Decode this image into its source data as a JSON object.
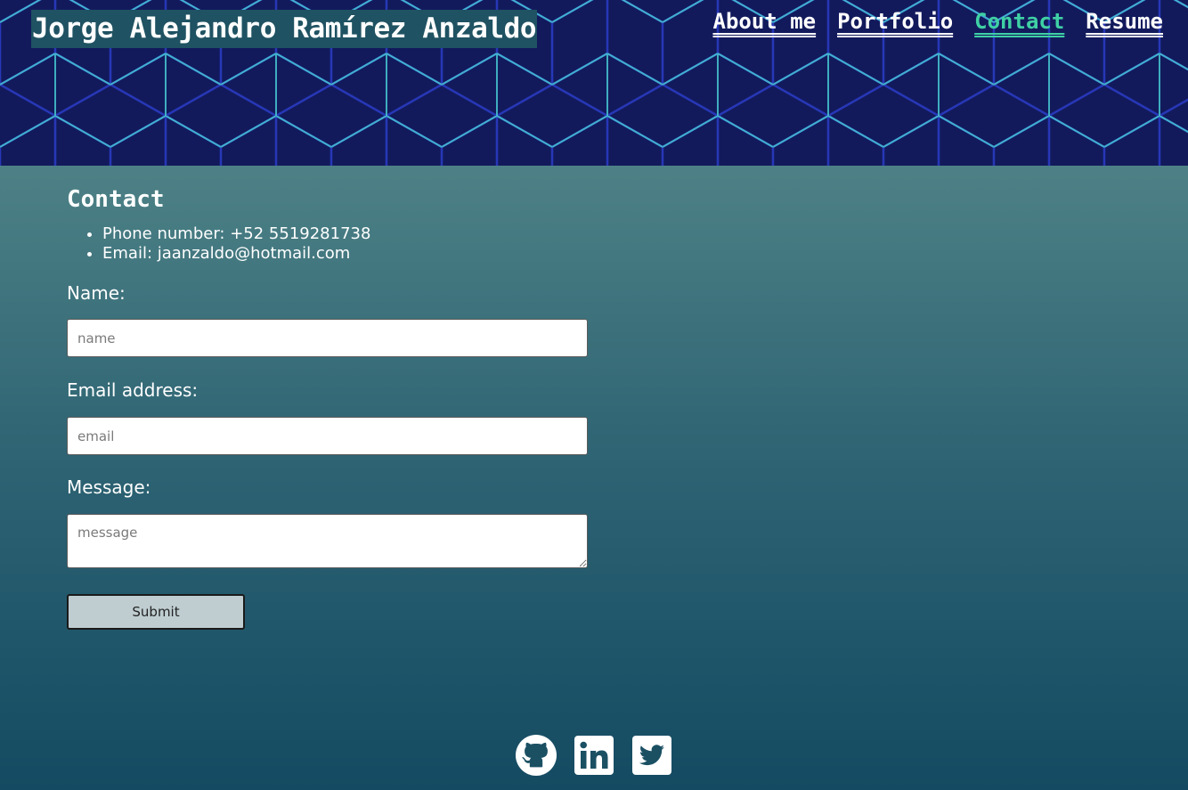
{
  "header": {
    "site_title": "Jorge Alejandro Ramírez Anzaldo",
    "nav": [
      {
        "label": "About me",
        "active": false
      },
      {
        "label": "Portfolio",
        "active": false
      },
      {
        "label": "Contact",
        "active": true
      },
      {
        "label": "Resume",
        "active": false
      }
    ]
  },
  "contact": {
    "title": "Contact",
    "details": [
      "Phone number: +52 5519281738",
      "Email: jaanzaldo@hotmail.com"
    ]
  },
  "form": {
    "name_label": "Name:",
    "name_placeholder": "name",
    "email_label": "Email address:",
    "email_placeholder": "email",
    "message_label": "Message:",
    "message_placeholder": "message",
    "submit_label": "Submit"
  },
  "footer": {
    "icons": [
      "github-icon",
      "linkedin-icon",
      "twitter-icon"
    ]
  },
  "colors": {
    "header_bg": "#121a5c",
    "title_bg": "#1f5262",
    "active_link": "#3fd0a4",
    "body_gradient_top": "#5f8d90",
    "body_gradient_bottom": "#154b62"
  }
}
